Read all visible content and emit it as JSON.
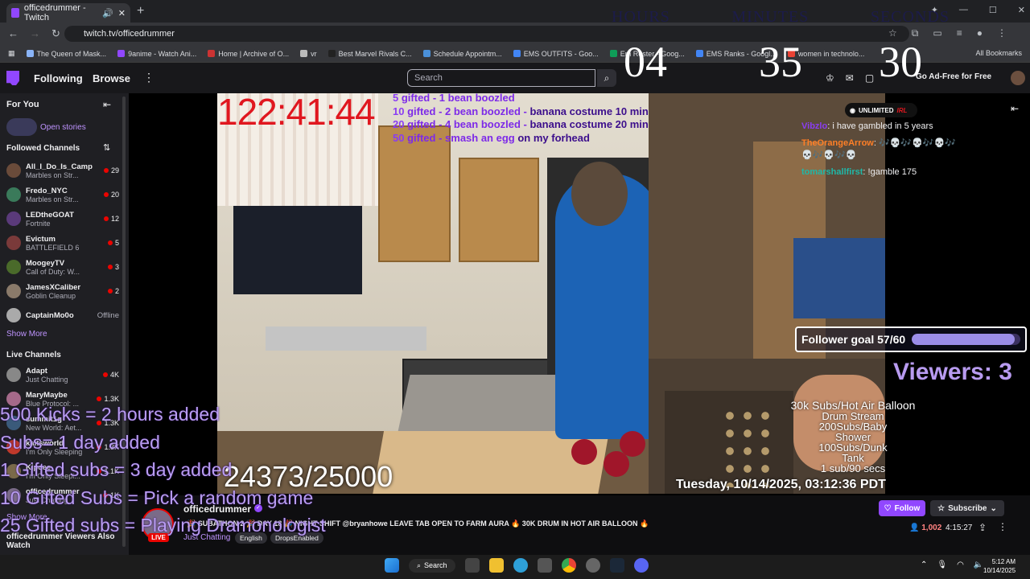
{
  "browser": {
    "tab_title": "officedrummer - Twitch",
    "url": "twitch.tv/officedrummer",
    "bookmarks": [
      "The Queen of Mask...",
      "9anime - Watch Ani...",
      "Home | Archive of O...",
      "vr",
      "Best Marvel Rivals C...",
      "Schedule Appointm...",
      "EMS OUTFITS - Goo...",
      "Em Roster - Goog...",
      "EMS Ranks - Googl...",
      "women in technolo..."
    ],
    "all_bookmarks": "All Bookmarks"
  },
  "timer": {
    "labels": [
      "HOURS",
      "MINUTES",
      "SECONDS"
    ],
    "hours": "04",
    "minutes": "35",
    "seconds": "30"
  },
  "twitch_nav": {
    "following": "Following",
    "browse": "Browse",
    "search_placeholder": "Search",
    "ad_free": "Go Ad-Free for Free"
  },
  "sidebar": {
    "for_you": "For You",
    "open_stories": "Open stories",
    "followed_header": "Followed Channels",
    "followed": [
      {
        "name": "All_I_Do_Is_Camp",
        "game": "Marbles on Str...",
        "count": "29",
        "color": "#6a4b3a"
      },
      {
        "name": "Fredo_NYC",
        "game": "Marbles on Str...",
        "count": "20",
        "color": "#3a7a5a"
      },
      {
        "name": "LEDtheGOAT",
        "game": "Fortnite",
        "count": "12",
        "color": "#5a3a7a"
      },
      {
        "name": "Evictum",
        "game": "BATTLEFIELD 6",
        "count": "5",
        "color": "#7a3a3a"
      },
      {
        "name": "MoogeyTV",
        "game": "Call of Duty: W...",
        "count": "3",
        "color": "#4a6a2a"
      },
      {
        "name": "JamesXCaliber",
        "game": "Goblin Cleanup",
        "count": "2",
        "color": "#8a7a6a"
      }
    ],
    "offline_channel": {
      "name": "CaptainMo0o",
      "status": "Offline"
    },
    "show_more": "Show More",
    "live_header": "Live Channels",
    "live": [
      {
        "name": "Adapt",
        "game": "Just Chatting",
        "count": "4K",
        "color": "#888"
      },
      {
        "name": "MaryMaybe",
        "game": "Blue Protocol: ...",
        "count": "1.3K",
        "color": "#a56a8a"
      },
      {
        "name": "summit1g",
        "game": "New World: Aet...",
        "count": "1.3K",
        "color": "#3a5a7a"
      },
      {
        "name": "kaitsworld",
        "game": "I'm Only Sleeping",
        "count": "1.3K",
        "color": "#c0392b"
      },
      {
        "name": "Kipcee",
        "game": "I'm Only Sleepi...",
        "count": "1.1K",
        "color": "#7a6a4a"
      },
      {
        "name": "officedrummer",
        "game": "Just Chatting",
        "count": "1K",
        "color": "#7a6b88"
      }
    ],
    "show_more_2": "Show More",
    "viewers_also_watch": "officedrummer Viewers Also Watch"
  },
  "overlay": {
    "big_timer": "122:41:44",
    "gifts": [
      {
        "num": "5",
        "text": "gifted - 1 bean boozled",
        "extra": ""
      },
      {
        "num": "10",
        "text": "gifted - 2 bean boozled - ",
        "extra": "banana costume 10 min"
      },
      {
        "num": "20",
        "text": "gifted - 4 bean boozled - ",
        "extra": "banana costume 20 min"
      },
      {
        "num": "50",
        "text": "gifted - smash an egg ",
        "extra": "on my forhead"
      }
    ],
    "unlimited": "UNLIMITED",
    "irl": "IRL",
    "follower_goal": "Follower goal 57/60",
    "follower_goal_fraction": 0.95,
    "viewers": "Viewers: 3",
    "milestones": [
      "30k Subs/Hot Air Balloon",
      "Drum Stream",
      "200Subs/Baby",
      "Shower",
      "100Subs/Dunk",
      "Tank",
      "1 sub/90 secs"
    ],
    "sub_count": "24373/25000",
    "datetime": "Tuesday, 10/14/2025, 03:12:36 PDT",
    "kick_rules": [
      "500 Kicks = 2 hours added",
      "Subs= 1 day added",
      "1 Gifted subs = 3 day added",
      "10 Gifted Subs = Pick a random game",
      "25 Gifted subs = Playing Dramonologist"
    ]
  },
  "chat": [
    {
      "name": "Vibzlo",
      "color": "#8a3df2",
      "text": ": i have gambled in 5 years"
    },
    {
      "name": "TheOrangeArrow",
      "color": "#ff7f27",
      "text": ": 🎶💀🎶💀🎶💀🎶💀🎶💀🎶💀"
    },
    {
      "name": "tomarshallfirst",
      "color": "#1fb8a8",
      "text": ": !gamble 175"
    }
  ],
  "channel": {
    "name": "officedrummer",
    "live": "LIVE",
    "title": "🎉 SUBATHON 2 🎉 DAY 18 🎉 NIGHT SHIFT @bryanhowe LEAVE TAB OPEN TO FARM AURA 🔥 30K DRUM IN HOT AIR BALLOON 🔥",
    "category": "Just Chatting",
    "tags": [
      "English",
      "DropsEnabled"
    ],
    "follow": "Follow",
    "subscribe": "Subscribe",
    "viewer_count": "1,002",
    "uptime": "4:15:27"
  },
  "taskbar": {
    "search": "Search",
    "time": "5:12 AM",
    "date": "10/14/2025"
  }
}
